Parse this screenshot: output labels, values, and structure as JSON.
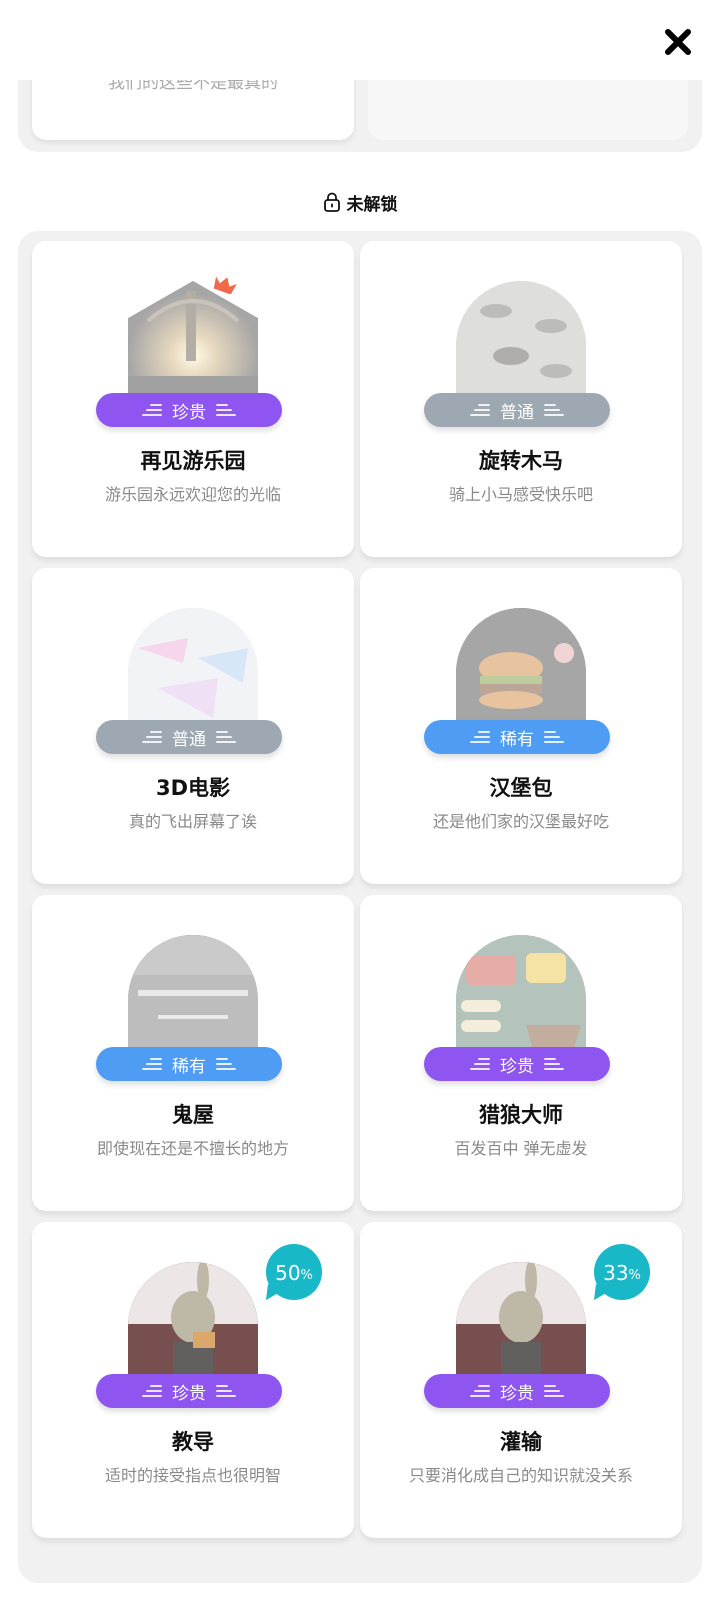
{
  "partial_card": {
    "desc": "我们的这些不是最真的"
  },
  "locked_section": {
    "title": "未解锁"
  },
  "colors": {
    "precious": "#8f55f0",
    "common": "#9ea8b3",
    "rare": "#4f9cf5",
    "progress": "#19b8c8",
    "crown": "#f06a4a"
  },
  "cards": [
    {
      "title": "再见游乐园",
      "desc": "游乐园永远欢迎您的光临",
      "rarity": "珍贵",
      "rarity_type": "precious",
      "icon": "amusement-park-hexagon-image"
    },
    {
      "title": "旋转木马",
      "desc": "骑上小马感受快乐吧",
      "rarity": "普通",
      "rarity_type": "common",
      "icon": "carousel-image"
    },
    {
      "title": "3D电影",
      "desc": "真的飞出屏幕了诶",
      "rarity": "普通",
      "rarity_type": "common",
      "icon": "3d-movie-image"
    },
    {
      "title": "汉堡包",
      "desc": "还是他们家的汉堡最好吃",
      "rarity": "稀有",
      "rarity_type": "rare",
      "icon": "hamburger-image"
    },
    {
      "title": "鬼屋",
      "desc": "即使现在还是不擅长的地方",
      "rarity": "稀有",
      "rarity_type": "rare",
      "icon": "haunted-house-image"
    },
    {
      "title": "猎狼大师",
      "desc": "百发百中 弹无虚发",
      "rarity": "珍贵",
      "rarity_type": "precious",
      "icon": "wolf-hunter-game-image"
    },
    {
      "title": "教导",
      "desc": "适时的接受指点也很明智",
      "rarity": "珍贵",
      "rarity_type": "precious",
      "icon": "rabbit-theater-image",
      "progress": "50",
      "progress_unit": "%"
    },
    {
      "title": "灌输",
      "desc": "只要消化成自己的知识就没关系",
      "rarity": "珍贵",
      "rarity_type": "precious",
      "icon": "rabbit-theater-image",
      "progress": "33",
      "progress_unit": "%"
    }
  ]
}
